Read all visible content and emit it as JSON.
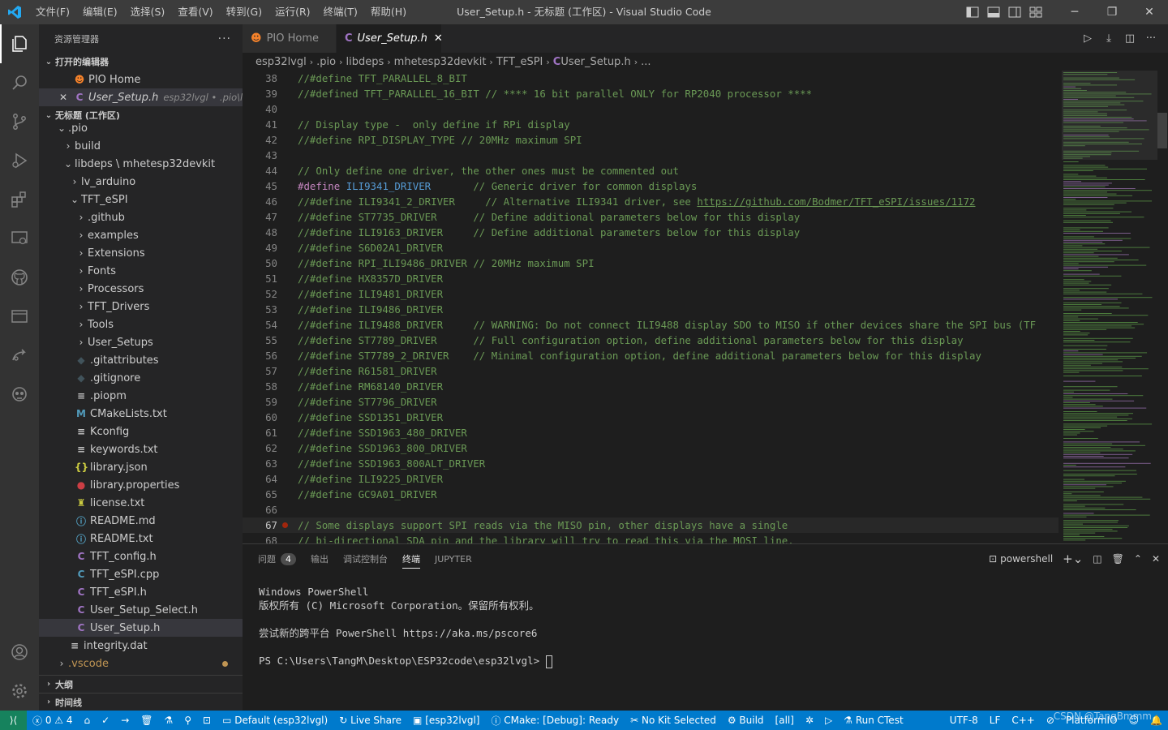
{
  "app": {
    "title": "User_Setup.h - 无标题 (工作区) - Visual Studio Code",
    "menu": [
      "文件(F)",
      "编辑(E)",
      "选择(S)",
      "查看(V)",
      "转到(G)",
      "运行(R)",
      "终端(T)",
      "帮助(H)"
    ],
    "accent": "#007acc"
  },
  "sidebar": {
    "header": "资源管理器",
    "open_editors_title": "打开的编辑器",
    "open_editors": [
      {
        "label": "PIO Home",
        "icon": "platformio-icon"
      },
      {
        "label": "User_Setup.h",
        "desc": "esp32lvgl • .pio\\libd...",
        "icon": "c-file-icon"
      }
    ],
    "workspace_title": "无标题 (工作区)",
    "tree": [
      {
        "label": ".pio",
        "kind": "folder-open"
      },
      {
        "label": "build",
        "kind": "folder"
      },
      {
        "label": "libdeps \\ mhetesp32devkit",
        "kind": "folder-open"
      },
      {
        "label": "lv_arduino",
        "kind": "folder"
      },
      {
        "label": "TFT_eSPI",
        "kind": "folder-open"
      },
      {
        "label": ".github",
        "kind": "folder"
      },
      {
        "label": "examples",
        "kind": "folder"
      },
      {
        "label": "Extensions",
        "kind": "folder"
      },
      {
        "label": "Fonts",
        "kind": "folder"
      },
      {
        "label": "Processors",
        "kind": "folder"
      },
      {
        "label": "TFT_Drivers",
        "kind": "folder"
      },
      {
        "label": "Tools",
        "kind": "folder"
      },
      {
        "label": "User_Setups",
        "kind": "folder"
      },
      {
        "label": ".gitattributes",
        "kind": "git"
      },
      {
        "label": ".gitignore",
        "kind": "git"
      },
      {
        "label": ".piopm",
        "kind": "text"
      },
      {
        "label": "CMakeLists.txt",
        "kind": "cmake"
      },
      {
        "label": "Kconfig",
        "kind": "text"
      },
      {
        "label": "keywords.txt",
        "kind": "text"
      },
      {
        "label": "library.json",
        "kind": "json"
      },
      {
        "label": "library.properties",
        "kind": "props"
      },
      {
        "label": "license.txt",
        "kind": "license"
      },
      {
        "label": "README.md",
        "kind": "info"
      },
      {
        "label": "README.txt",
        "kind": "info"
      },
      {
        "label": "TFT_config.h",
        "kind": "c"
      },
      {
        "label": "TFT_eSPI.cpp",
        "kind": "cpp"
      },
      {
        "label": "TFT_eSPI.h",
        "kind": "c"
      },
      {
        "label": "User_Setup_Select.h",
        "kind": "c"
      },
      {
        "label": "User_Setup.h",
        "kind": "c"
      },
      {
        "label": "integrity.dat",
        "kind": "text"
      },
      {
        "label": ".vscode",
        "kind": "folder"
      }
    ],
    "outline_title": "大纲",
    "timeline_title": "时间线"
  },
  "tabs": [
    {
      "label": "PIO Home"
    },
    {
      "label": "User_Setup.h"
    }
  ],
  "breadcrumb": [
    "esp32lvgl",
    ".pio",
    "libdeps",
    "mhetesp32devkit",
    "TFT_eSPI",
    "User_Setup.h",
    "..."
  ],
  "editor": {
    "lines": [
      {
        "n": "38",
        "text": "//#define TFT_PARALLEL_8_BIT"
      },
      {
        "n": "39",
        "text": "//#defined TFT_PARALLEL_16_BIT // **** 16 bit parallel ONLY for RP2040 processor ****"
      },
      {
        "n": "40",
        "text": ""
      },
      {
        "n": "41",
        "text": "// Display type -  only define if RPi display"
      },
      {
        "n": "42",
        "text": "//#define RPI_DISPLAY_TYPE // 20MHz maximum SPI"
      },
      {
        "n": "43",
        "text": ""
      },
      {
        "n": "44",
        "text": "// Only define one driver, the other ones must be commented out"
      },
      {
        "n": "45",
        "text": "#define ILI9341_DRIVER       // Generic driver for common displays"
      },
      {
        "n": "46",
        "text": "//#define ILI9341_2_DRIVER     // Alternative ILI9341 driver, see https://github.com/Bodmer/TFT_eSPI/issues/1172"
      },
      {
        "n": "47",
        "text": "//#define ST7735_DRIVER      // Define additional parameters below for this display"
      },
      {
        "n": "48",
        "text": "//#define ILI9163_DRIVER     // Define additional parameters below for this display"
      },
      {
        "n": "49",
        "text": "//#define S6D02A1_DRIVER"
      },
      {
        "n": "50",
        "text": "//#define RPI_ILI9486_DRIVER // 20MHz maximum SPI"
      },
      {
        "n": "51",
        "text": "//#define HX8357D_DRIVER"
      },
      {
        "n": "52",
        "text": "//#define ILI9481_DRIVER"
      },
      {
        "n": "53",
        "text": "//#define ILI9486_DRIVER"
      },
      {
        "n": "54",
        "text": "//#define ILI9488_DRIVER     // WARNING: Do not connect ILI9488 display SDO to MISO if other devices share the SPI bus (TF"
      },
      {
        "n": "55",
        "text": "//#define ST7789_DRIVER      // Full configuration option, define additional parameters below for this display"
      },
      {
        "n": "56",
        "text": "//#define ST7789_2_DRIVER    // Minimal configuration option, define additional parameters below for this display"
      },
      {
        "n": "57",
        "text": "//#define R61581_DRIVER"
      },
      {
        "n": "58",
        "text": "//#define RM68140_DRIVER"
      },
      {
        "n": "59",
        "text": "//#define ST7796_DRIVER"
      },
      {
        "n": "60",
        "text": "//#define SSD1351_DRIVER"
      },
      {
        "n": "61",
        "text": "//#define SSD1963_480_DRIVER"
      },
      {
        "n": "62",
        "text": "//#define SSD1963_800_DRIVER"
      },
      {
        "n": "63",
        "text": "//#define SSD1963_800ALT_DRIVER"
      },
      {
        "n": "64",
        "text": "//#define ILI9225_DRIVER"
      },
      {
        "n": "65",
        "text": "//#define GC9A01_DRIVER"
      },
      {
        "n": "66",
        "text": ""
      },
      {
        "n": "67",
        "text": "// Some displays support SPI reads via the MISO pin, other displays have a single"
      },
      {
        "n": "68",
        "text": "// bi-directional SDA pin and the library will try to read this via the MOSI line."
      }
    ],
    "active_line": "67",
    "breakpoint_line": "67"
  },
  "panel": {
    "tabs": [
      {
        "label": "问题",
        "badge": "4"
      },
      {
        "label": "输出"
      },
      {
        "label": "调试控制台"
      },
      {
        "label": "终端"
      },
      {
        "label": "JUPYTER"
      }
    ],
    "active_tab": "终端",
    "shell": "powershell",
    "terminal": [
      "Windows PowerShell",
      "版权所有 (C) Microsoft Corporation。保留所有权利。",
      "",
      "尝试新的跨平台 PowerShell https://aka.ms/pscore6",
      "",
      "PS C:\\Users\\TangM\\Desktop\\ESP32code\\esp32lvgl> "
    ]
  },
  "status": {
    "errors": "0",
    "warnings": "4",
    "env": "Default (esp32lvgl)",
    "live_share": "Live Share",
    "project": "[esp32lvgl]",
    "cmake": "CMake: [Debug]: Ready",
    "kit": "No Kit Selected",
    "build": "Build",
    "target": "[all]",
    "ctest": "Run CTest",
    "encoding": "UTF-8",
    "eol": "LF",
    "language": "C++",
    "platform": "PlatformIO",
    "watermark": "CSDN @TangBmmm"
  }
}
